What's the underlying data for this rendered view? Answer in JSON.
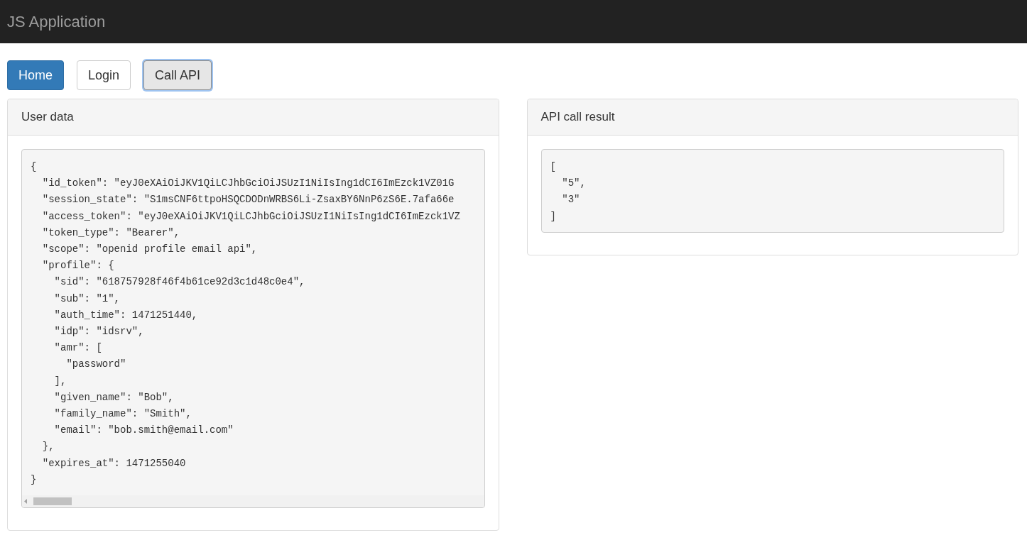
{
  "navbar": {
    "title": "JS Application"
  },
  "buttons": [
    {
      "label": "Home",
      "kind": "primary",
      "focused": false
    },
    {
      "label": "Login",
      "kind": "default",
      "focused": false
    },
    {
      "label": "Call API",
      "kind": "default",
      "focused": true
    }
  ],
  "panels": [
    {
      "title": "User data",
      "scrollbar": true,
      "content": "{\n  \"id_token\": \"eyJ0eXAiOiJKV1QiLCJhbGciOiJSUzI1NiIsIng1dCI6ImEzck1VZ01G\n  \"session_state\": \"S1msCNF6ttpoHSQCDODnWRBS6Li-ZsaxBY6NnP6zS6E.7afa66e\n  \"access_token\": \"eyJ0eXAiOiJKV1QiLCJhbGciOiJSUzI1NiIsIng1dCI6ImEzck1VZ\n  \"token_type\": \"Bearer\",\n  \"scope\": \"openid profile email api\",\n  \"profile\": {\n    \"sid\": \"618757928f46f4b61ce92d3c1d48c0e4\",\n    \"sub\": \"1\",\n    \"auth_time\": 1471251440,\n    \"idp\": \"idsrv\",\n    \"amr\": [\n      \"password\"\n    ],\n    \"given_name\": \"Bob\",\n    \"family_name\": \"Smith\",\n    \"email\": \"bob.smith@email.com\"\n  },\n  \"expires_at\": 1471255040\n}"
    },
    {
      "title": "API call result",
      "scrollbar": false,
      "content": "[\n  \"5\",\n  \"3\"\n]"
    }
  ]
}
